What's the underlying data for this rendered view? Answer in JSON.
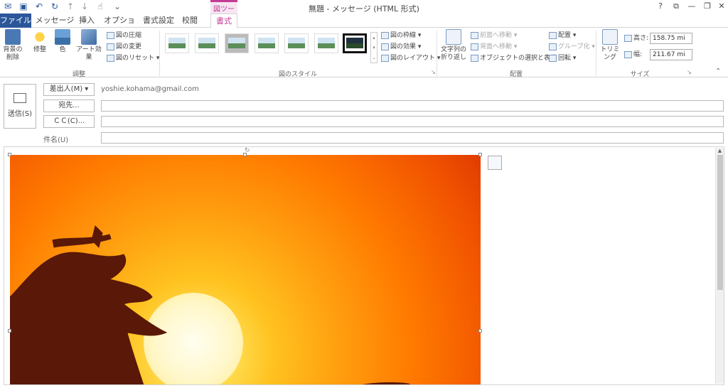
{
  "window": {
    "title": "無題 - メッセージ (HTML 形式)",
    "help": "?",
    "controls": [
      "?",
      "⧉",
      "—",
      "❐",
      "✕"
    ]
  },
  "qat": [
    "save-icon",
    "undo-icon",
    "redo-icon",
    "up-icon",
    "down-icon",
    "touch-icon",
    "customize-icon"
  ],
  "context_tab": {
    "label": "図ツール",
    "color": "#c33b94"
  },
  "tabs": {
    "file": "ファイル",
    "message": "メッセージ",
    "insert": "挿入",
    "options": "オプション",
    "format_text": "書式設定",
    "review": "校閲",
    "format": "書式"
  },
  "ribbon": {
    "adjust": {
      "remove_bg": "背景の削除",
      "corrections": "修整",
      "color": "色",
      "artistic": "アート効果",
      "compress": "図の圧縮",
      "change": "図の変更",
      "reset": "図のリセット",
      "group": "調整"
    },
    "styles": {
      "border": "図の枠線",
      "effects": "図の効果",
      "layout": "図のレイアウト",
      "group": "図のスタイル"
    },
    "arrange": {
      "wrap": "文字列の折り返し",
      "forward": "前面へ移動",
      "backward": "背面へ移動",
      "selection": "オブジェクトの選択と表示",
      "align": "配置",
      "group_btn": "グループ化",
      "rotate": "回転",
      "group": "配置"
    },
    "size": {
      "crop": "トリミング",
      "height_label": "高さ:",
      "height_value": "158.75 mi",
      "width_label": "幅:",
      "width_value": "211.67 mi",
      "group": "サイズ"
    }
  },
  "compose": {
    "send": "送信(S)",
    "from_btn": "差出人(M) ▾",
    "from_value": "yoshie.kohama@gmail.com",
    "to_btn": "宛先...",
    "cc_btn": "ＣＣ(C)...",
    "subject_label": "件名(U)",
    "to_value": "",
    "cc_value": "",
    "subject_value": ""
  },
  "colors": {
    "accent": "#2b579a",
    "context": "#c33b94"
  }
}
